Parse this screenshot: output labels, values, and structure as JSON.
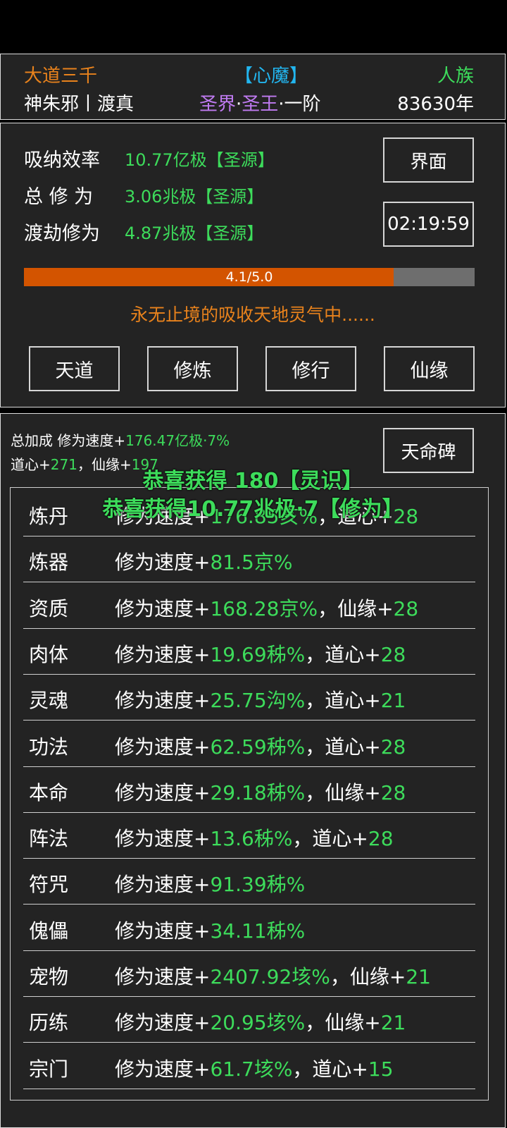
{
  "header": {
    "title_left": "大道三千",
    "title_center": "【心魔】",
    "title_right": "人族",
    "player": "神朱邪丨渡真",
    "realm_a": "圣界",
    "realm_dot1": "·",
    "realm_b": "圣王",
    "realm_c": "·一阶",
    "age": "83630年"
  },
  "stats": {
    "rows": [
      {
        "label": "吸纳效率",
        "value": "10.77亿极【圣源】"
      },
      {
        "label": "总 修 为",
        "value": "3.06兆极【圣源】"
      },
      {
        "label": "渡劫修为",
        "value": "4.87兆极【圣源】"
      }
    ],
    "interface_button": "界面",
    "timer": "02:19:59",
    "progress_text": "4.1/5.0",
    "progress_fraction": 0.82,
    "status_text": "永无止境的吸收天地灵气中......",
    "actions": [
      "天道",
      "修炼",
      "修行",
      "仙缘"
    ]
  },
  "bonus": {
    "line1_prefix": "总加成 修为速度+",
    "line1_value": "176.47亿极·7%",
    "line2_prefix": "道心+",
    "line2_value": "271",
    "line2_mid": "，仙缘+",
    "line2_value2": "197",
    "fate_button": "天命碑",
    "toast1": "恭喜获得 180【灵识】",
    "toast2": "恭喜获得10.77兆极·7【修为】",
    "items": [
      {
        "name": "炼丹",
        "prefix": "修为速度+",
        "value": "176.85亥%",
        "extra_label": "，道心+",
        "extra_value": "28"
      },
      {
        "name": "炼器",
        "prefix": "修为速度+",
        "value": "81.5京%",
        "extra_label": "",
        "extra_value": ""
      },
      {
        "name": "资质",
        "prefix": "修为速度+",
        "value": "168.28京%",
        "extra_label": "，仙缘+",
        "extra_value": "28"
      },
      {
        "name": "肉体",
        "prefix": "修为速度+",
        "value": "19.69秭%",
        "extra_label": "，道心+",
        "extra_value": "28"
      },
      {
        "name": "灵魂",
        "prefix": "修为速度+",
        "value": "25.75沟%",
        "extra_label": "，道心+",
        "extra_value": "21"
      },
      {
        "name": "功法",
        "prefix": "修为速度+",
        "value": "62.59秭%",
        "extra_label": "，道心+",
        "extra_value": "28"
      },
      {
        "name": "本命",
        "prefix": "修为速度+",
        "value": "29.18秭%",
        "extra_label": "，仙缘+",
        "extra_value": "28"
      },
      {
        "name": "阵法",
        "prefix": "修为速度+",
        "value": "13.6秭%",
        "extra_label": "，道心+",
        "extra_value": "28"
      },
      {
        "name": "符咒",
        "prefix": "修为速度+",
        "value": "91.39秭%",
        "extra_label": "",
        "extra_value": ""
      },
      {
        "name": "傀儡",
        "prefix": "修为速度+",
        "value": "34.11秭%",
        "extra_label": "",
        "extra_value": ""
      },
      {
        "name": "宠物",
        "prefix": "修为速度+",
        "value": "2407.92垓%",
        "extra_label": "，仙缘+",
        "extra_value": "21"
      },
      {
        "name": "历练",
        "prefix": "修为速度+",
        "value": "20.95垓%",
        "extra_label": "，仙缘+",
        "extra_value": "21"
      },
      {
        "name": "宗门",
        "prefix": "修为速度+",
        "value": "61.7垓%",
        "extra_label": "，道心+",
        "extra_value": "15"
      }
    ]
  },
  "colors": {
    "accent_orange": "#e8821c",
    "accent_green": "#3ddc5b",
    "accent_cyan": "#22b6f0",
    "accent_purple": "#c07bf2",
    "progress_fill": "#d35400",
    "panel_bg": "#232323"
  }
}
